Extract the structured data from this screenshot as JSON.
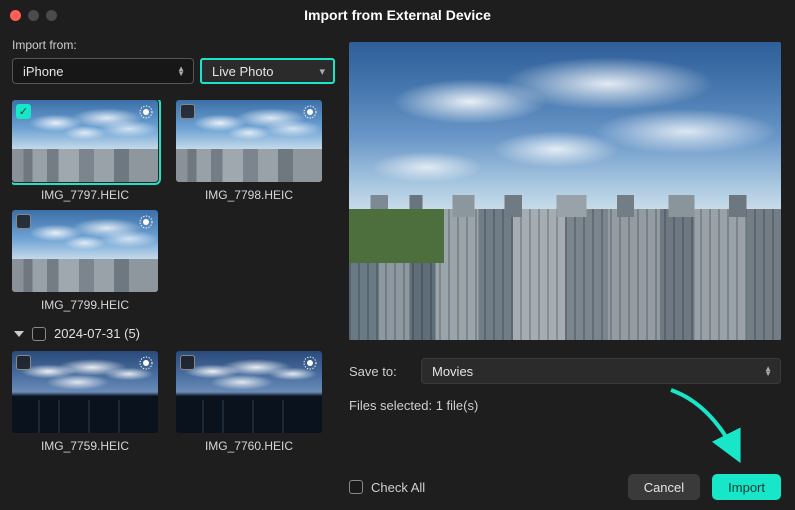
{
  "window": {
    "title": "Import from External Device"
  },
  "importFrom": {
    "label": "Import from:",
    "device": "iPhone",
    "type": "Live Photo"
  },
  "groups": [
    {
      "header": null,
      "items": [
        {
          "name": "IMG_7797.HEIC",
          "checked": true,
          "selected": true,
          "live": true,
          "variant": "day"
        },
        {
          "name": "IMG_7798.HEIC",
          "checked": false,
          "selected": false,
          "live": true,
          "variant": "day"
        },
        {
          "name": "IMG_7799.HEIC",
          "checked": false,
          "selected": false,
          "live": true,
          "variant": "day"
        }
      ]
    },
    {
      "header": "2024-07-31 (5)",
      "items": [
        {
          "name": "IMG_7759.HEIC",
          "checked": false,
          "selected": false,
          "live": true,
          "variant": "dusk"
        },
        {
          "name": "IMG_7760.HEIC",
          "checked": false,
          "selected": false,
          "live": true,
          "variant": "dusk"
        }
      ]
    }
  ],
  "saveTo": {
    "label": "Save to:",
    "value": "Movies"
  },
  "filesSelected": "Files selected: 1 file(s)",
  "checkAll": {
    "label": "Check All",
    "checked": false
  },
  "buttons": {
    "cancel": "Cancel",
    "import": "Import"
  },
  "colors": {
    "accent": "#17e6c8"
  }
}
